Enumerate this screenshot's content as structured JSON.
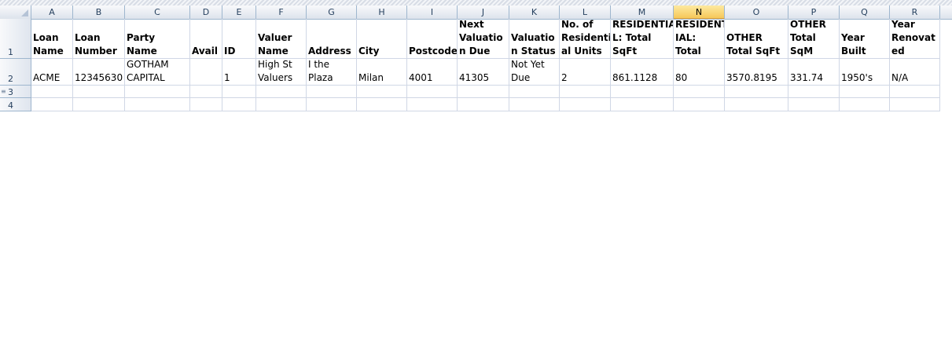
{
  "sheet": {
    "selected_column": "N",
    "columns": [
      "A",
      "B",
      "C",
      "D",
      "E",
      "F",
      "G",
      "H",
      "I",
      "J",
      "K",
      "L",
      "M",
      "N",
      "O",
      "P",
      "Q",
      "R"
    ],
    "row_numbers": [
      "1",
      "2",
      "3",
      "4"
    ],
    "header_row": [
      "Loan\nName",
      "Loan\nNumber",
      "Party Name",
      "Avail",
      "ID",
      "Valuer\nName",
      "Address",
      "City",
      "Postcode",
      "Next\nValuatio\nn Due",
      "Valuatio\nn Status",
      "No. of\nResidenti\nal Units",
      "RESIDENTIA\nL: Total\nSqFt",
      "RESIDENT\nIAL:\nTotal",
      "OTHER\nTotal SqFt",
      "OTHER\nTotal\nSqM",
      "Year\nBuilt",
      "Year\nRenovat\ned"
    ],
    "data_row": [
      "ACME",
      "12345630",
      "GOTHAM\nCAPITAL",
      "",
      "1",
      "High St\nValuers",
      "I the\nPlaza",
      "Milan",
      "4001",
      "41305",
      "Not Yet\nDue",
      "2",
      "861.1128",
      "80",
      "3570.8195",
      "331.74",
      "1950's",
      "N/A"
    ]
  }
}
